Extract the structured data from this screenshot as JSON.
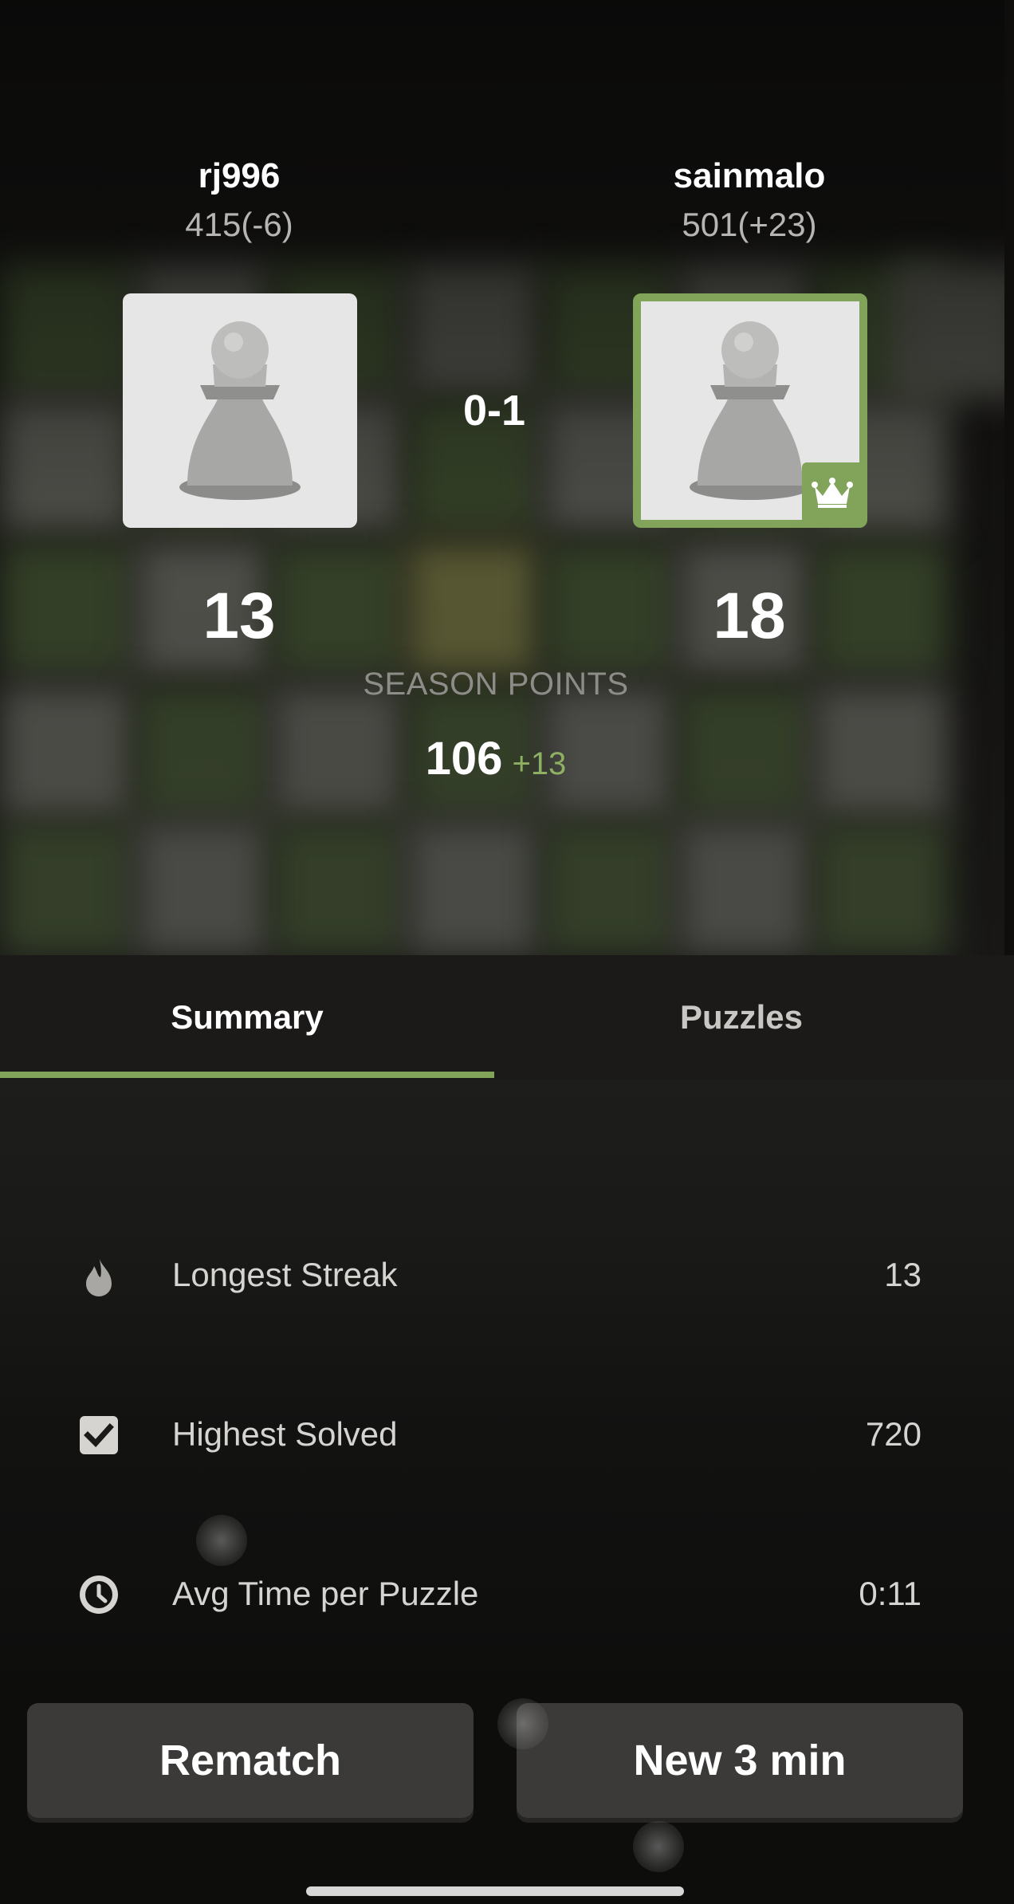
{
  "players": {
    "left": {
      "name": "rj996",
      "rating": "415(-6)",
      "score": "13"
    },
    "right": {
      "name": "sainmalo",
      "rating": "501(+23)",
      "score": "18"
    }
  },
  "result": "0-1",
  "season": {
    "label": "SEASON POINTS",
    "points": "106",
    "delta": "+13"
  },
  "tabs": [
    {
      "label": "Summary",
      "active": true
    },
    {
      "label": "Puzzles",
      "active": false
    }
  ],
  "summary": [
    {
      "icon": "flame-icon",
      "label": "Longest Streak",
      "value": "13"
    },
    {
      "icon": "checkbox-icon",
      "label": "Highest Solved",
      "value": "720"
    },
    {
      "icon": "clock-icon",
      "label": "Avg Time per Puzzle",
      "value": "0:11"
    }
  ],
  "buttons": {
    "rematch": "Rematch",
    "new_game": "New 3 min"
  },
  "colors": {
    "accent_green": "#81a35a",
    "background": "#0f0e0d",
    "button": "#3b3a38"
  }
}
